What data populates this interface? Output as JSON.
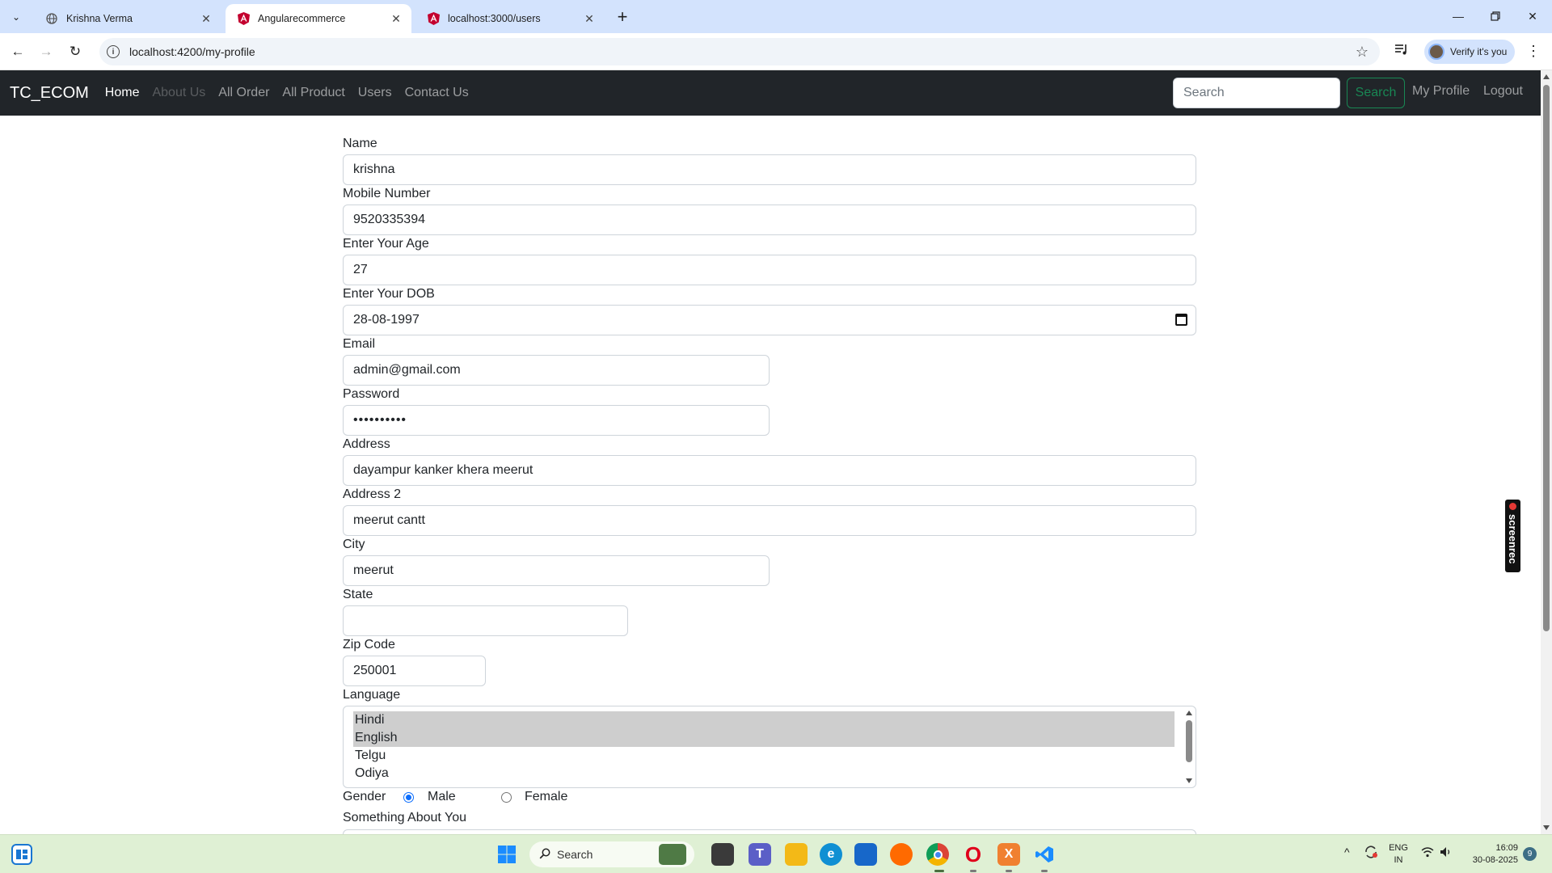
{
  "browser": {
    "tabs": [
      {
        "title": "Krishna Verma",
        "active": false
      },
      {
        "title": "Angularecommerce",
        "active": true
      },
      {
        "title": "localhost:3000/users",
        "active": false
      }
    ],
    "url": "localhost:4200/my-profile",
    "verify_label": "Verify it's you"
  },
  "nav": {
    "brand": "TC_ECOM",
    "links": [
      "Home",
      "About Us",
      "All Order",
      "All Product",
      "Users",
      "Contact Us"
    ],
    "search_placeholder": "Search",
    "search_button": "Search",
    "my_profile": "My Profile",
    "logout": "Logout"
  },
  "form": {
    "name_label": "Name",
    "name_value": "krishna",
    "mobile_label": "Mobile Number",
    "mobile_value": "9520335394",
    "age_label": "Enter Your Age",
    "age_value": "27",
    "dob_label": "Enter Your DOB",
    "dob_value": "28-08-1997",
    "email_label": "Email",
    "email_value": "admin@gmail.com",
    "password_label": "Password",
    "password_value": "••••••••••",
    "address_label": "Address",
    "address_value": "dayampur kanker khera meerut",
    "address2_label": "Address 2",
    "address2_value": "meerut cantt",
    "city_label": "City",
    "city_value": "meerut",
    "state_label": "State",
    "state_value": "",
    "zip_label": "Zip Code",
    "zip_value": "250001",
    "language_label": "Language",
    "languages": [
      {
        "label": "Hindi",
        "selected": true
      },
      {
        "label": "English",
        "selected": true
      },
      {
        "label": "Telgu",
        "selected": false
      },
      {
        "label": "Odiya",
        "selected": false
      }
    ],
    "gender_label": "Gender",
    "gender_options": [
      "Male",
      "Female"
    ],
    "gender_selected": "Male",
    "about_label": "Something About You"
  },
  "widget": {
    "screenrec_label": "screenrec"
  },
  "taskbar": {
    "search_label": "Search",
    "lang_line1": "ENG",
    "lang_line2": "IN",
    "time": "16:09",
    "date": "30-08-2025",
    "notification_count": "9"
  },
  "colors": {
    "navbar_bg": "#212529",
    "search_btn": "#198754",
    "tabstrip_bg": "#d3e3fd",
    "taskbar_bg": "#dff0d4",
    "radio_checked": "#0d6efd"
  }
}
